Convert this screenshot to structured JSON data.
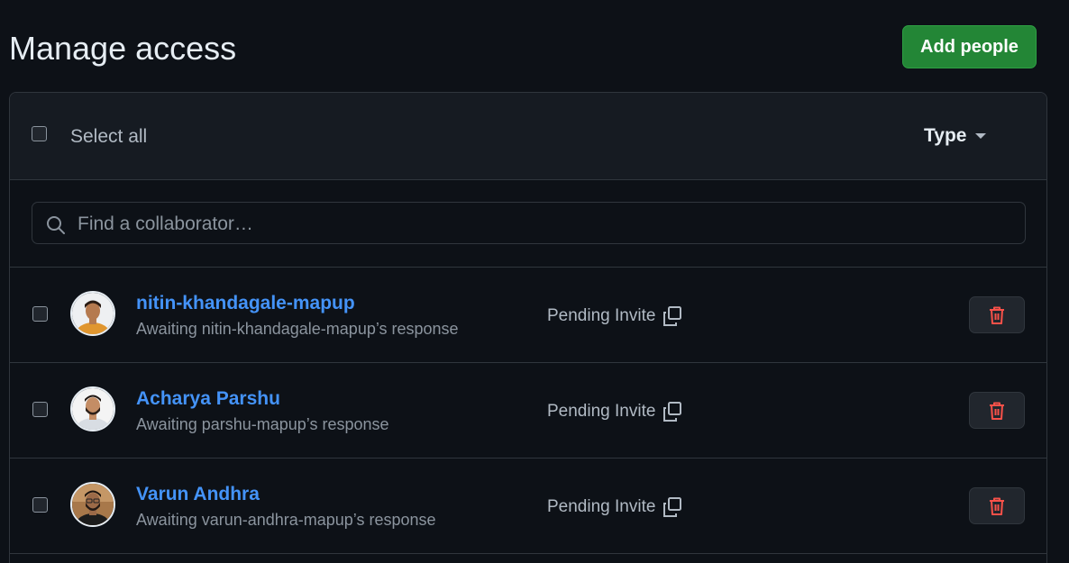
{
  "page_title": "Manage access",
  "add_button_label": "Add people",
  "header": {
    "select_all_label": "Select all",
    "type_filter_label": "Type"
  },
  "search": {
    "placeholder": "Find a collaborator…",
    "value": ""
  },
  "colors": {
    "accent_green": "#238636",
    "link_blue": "#4493f8",
    "danger_red": "#f85149",
    "background": "#0d1117"
  },
  "collaborators": [
    {
      "name": "nitin-khandagale-mapup",
      "subtitle": "Awaiting nitin-khandagale-mapup’s response",
      "status": "Pending Invite"
    },
    {
      "name": "Acharya Parshu",
      "subtitle": "Awaiting parshu-mapup’s response",
      "status": "Pending Invite"
    },
    {
      "name": "Varun Andhra",
      "subtitle": "Awaiting varun-andhra-mapup’s response",
      "status": "Pending Invite"
    }
  ]
}
